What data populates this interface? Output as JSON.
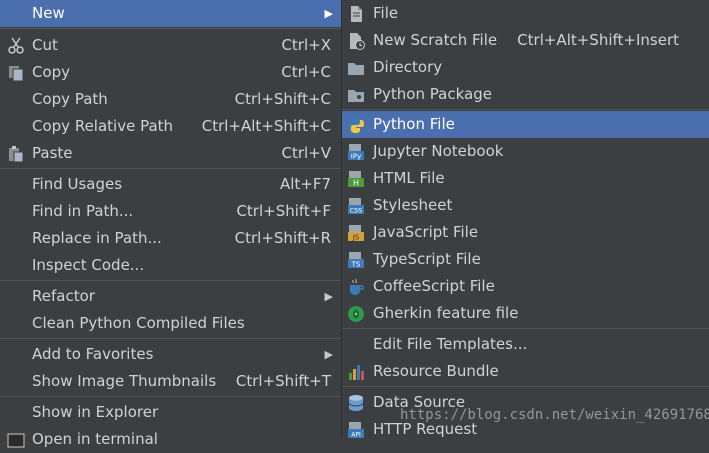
{
  "context_menu": {
    "items": [
      {
        "label": "New",
        "shortcut": ""
      },
      {
        "label": "Cut",
        "shortcut": "Ctrl+X"
      },
      {
        "label": "Copy",
        "shortcut": "Ctrl+C"
      },
      {
        "label": "Copy Path",
        "shortcut": "Ctrl+Shift+C"
      },
      {
        "label": "Copy Relative Path",
        "shortcut": "Ctrl+Alt+Shift+C"
      },
      {
        "label": "Paste",
        "shortcut": "Ctrl+V"
      },
      {
        "label": "Find Usages",
        "shortcut": "Alt+F7"
      },
      {
        "label": "Find in Path...",
        "shortcut": "Ctrl+Shift+F"
      },
      {
        "label": "Replace in Path...",
        "shortcut": "Ctrl+Shift+R"
      },
      {
        "label": "Inspect Code...",
        "shortcut": ""
      },
      {
        "label": "Refactor",
        "shortcut": ""
      },
      {
        "label": "Clean Python Compiled Files",
        "shortcut": ""
      },
      {
        "label": "Add to Favorites",
        "shortcut": ""
      },
      {
        "label": "Show Image Thumbnails",
        "shortcut": "Ctrl+Shift+T"
      },
      {
        "label": "Show in Explorer",
        "shortcut": ""
      },
      {
        "label": "Open in terminal",
        "shortcut": ""
      }
    ],
    "selected": "New"
  },
  "new_submenu": {
    "items": [
      {
        "label": "File",
        "shortcut": ""
      },
      {
        "label": "New Scratch File",
        "shortcut": "Ctrl+Alt+Shift+Insert"
      },
      {
        "label": "Directory",
        "shortcut": ""
      },
      {
        "label": "Python Package",
        "shortcut": ""
      },
      {
        "label": "Python File",
        "shortcut": ""
      },
      {
        "label": "Jupyter Notebook",
        "shortcut": ""
      },
      {
        "label": "HTML File",
        "shortcut": ""
      },
      {
        "label": "Stylesheet",
        "shortcut": ""
      },
      {
        "label": "JavaScript File",
        "shortcut": ""
      },
      {
        "label": "TypeScript File",
        "shortcut": ""
      },
      {
        "label": "CoffeeScript File",
        "shortcut": ""
      },
      {
        "label": "Gherkin feature file",
        "shortcut": ""
      },
      {
        "label": "Edit File Templates...",
        "shortcut": ""
      },
      {
        "label": "Resource Bundle",
        "shortcut": ""
      },
      {
        "label": "Data Source",
        "shortcut": ""
      },
      {
        "label": "HTTP Request",
        "shortcut": ""
      }
    ],
    "selected": "Python File",
    "icon_text": {
      "jupyter": "IPy",
      "html": "H",
      "css": "CSS",
      "js": "JS",
      "ts": "TS",
      "api": "API"
    }
  },
  "watermark": "https://blog.csdn.net/weixin_42691768",
  "colors": {
    "menu_bg": "#3c3f41",
    "selection": "#4b6eaf",
    "text": "#d2d2d2",
    "separator": "#515658"
  }
}
